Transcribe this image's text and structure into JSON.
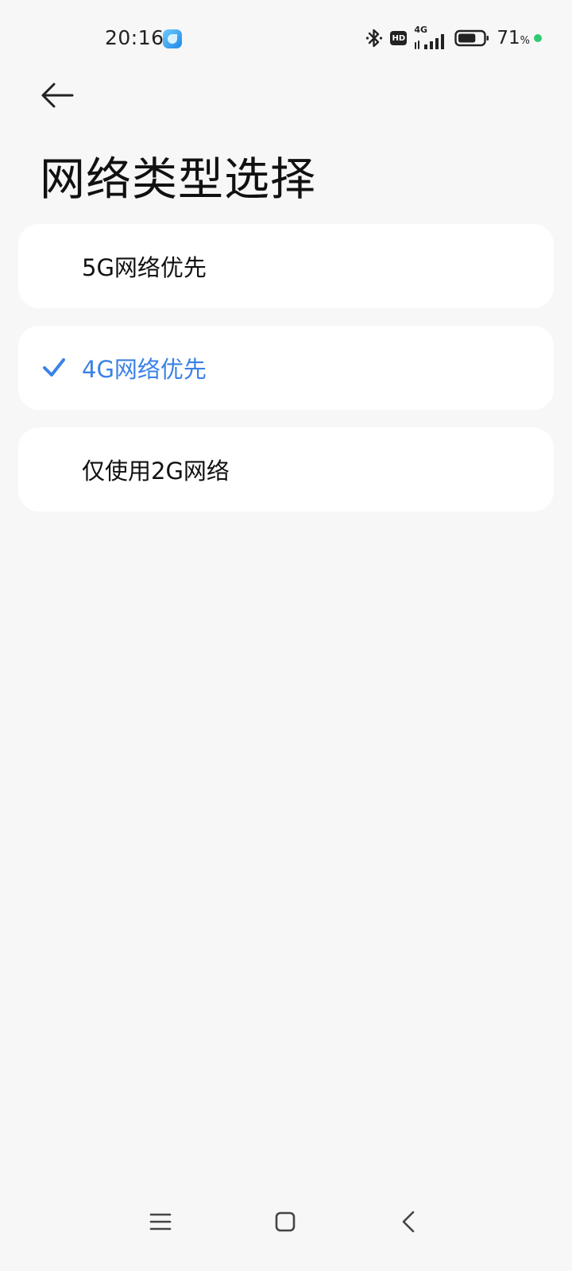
{
  "status_bar": {
    "time": "20:16",
    "hd_label": "HD",
    "network_type": "4G",
    "battery_percent": "71",
    "battery_unit": "%",
    "battery_level": 0.71,
    "charging_dot_color": "#2ecc71"
  },
  "header": {
    "back_icon": "arrow-left-icon",
    "title": "网络类型选择"
  },
  "options": [
    {
      "label": "5G网络优先",
      "selected": false
    },
    {
      "label": "4G网络优先",
      "selected": true
    },
    {
      "label": "仅使用2G网络",
      "selected": false
    }
  ],
  "colors": {
    "accent": "#3a82e6",
    "background": "#f7f7f7",
    "card": "#ffffff"
  },
  "nav_bar": {
    "icons": [
      "menu-icon",
      "home-square-icon",
      "back-chevron-icon"
    ]
  }
}
